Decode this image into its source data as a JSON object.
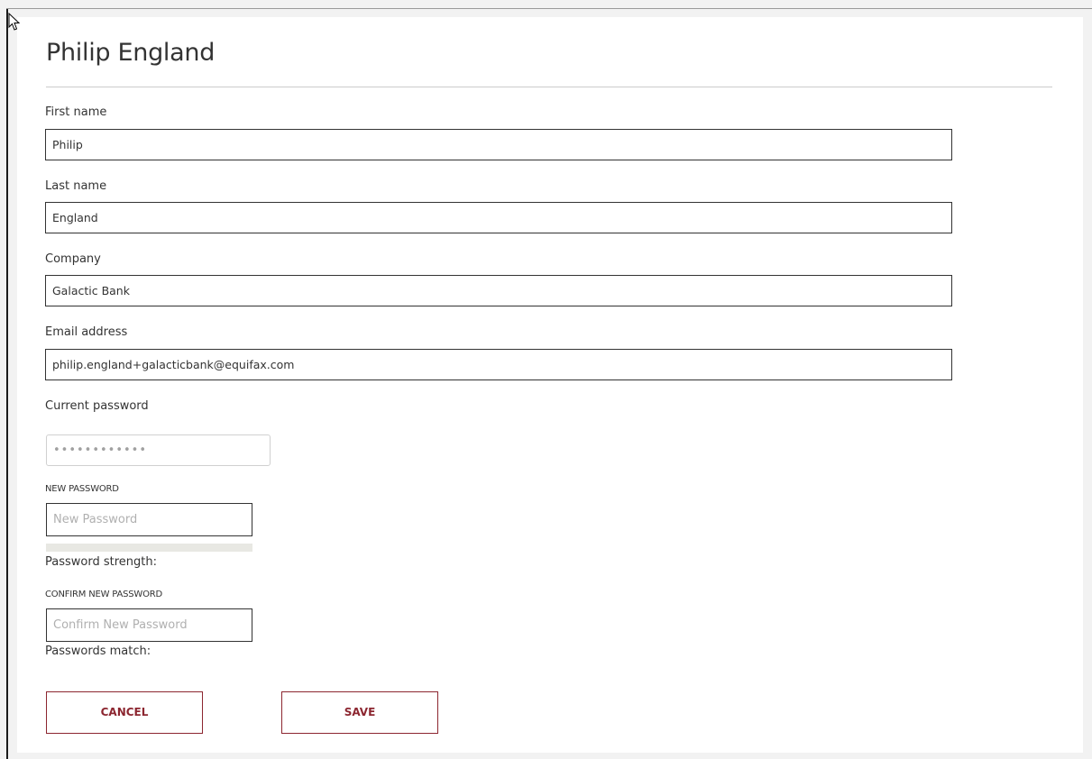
{
  "profile": {
    "title": "Philip England"
  },
  "form": {
    "first_name": {
      "label": "First name",
      "value": "Philip"
    },
    "last_name": {
      "label": "Last name",
      "value": "England"
    },
    "company": {
      "label": "Company",
      "value": "Galactic Bank"
    },
    "email": {
      "label": "Email address",
      "value": "philip.england+galacticbank@equifax.com"
    },
    "current_password": {
      "label": "Current password",
      "value": "••••••••••••"
    },
    "new_password": {
      "label": "NEW PASSWORD",
      "placeholder": "New Password",
      "value": "",
      "strength_label": "Password strength:",
      "strength_fraction": 0
    },
    "confirm_password": {
      "label": "CONFIRM NEW PASSWORD",
      "placeholder": "Confirm New Password",
      "value": "",
      "match_label": "Passwords match:"
    }
  },
  "actions": {
    "cancel_label": "CANCEL",
    "save_label": "SAVE"
  },
  "icons": {
    "cursor": "arrow-cursor-icon"
  },
  "colors": {
    "accent": "#8c2630",
    "text": "#333333",
    "strength_track": "#e8e8e3"
  }
}
